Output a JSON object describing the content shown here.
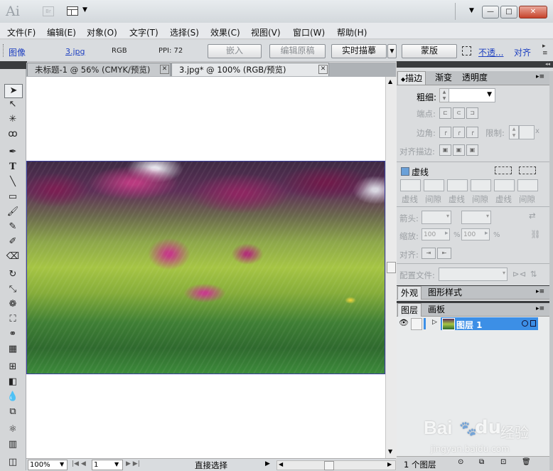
{
  "app": {
    "logo": "Ai",
    "bridge_badge": "Br"
  },
  "window_controls": {
    "minimize": "—",
    "maximize": "□",
    "close": "✕"
  },
  "menu": [
    "文件(F)",
    "编辑(E)",
    "对象(O)",
    "文字(T)",
    "选择(S)",
    "效果(C)",
    "视图(V)",
    "窗口(W)",
    "帮助(H)"
  ],
  "control_bar": {
    "object_type": "图像",
    "filename": "3.jpg",
    "color_mode": "RGB",
    "ppi": "PPI: 72",
    "embed_button": "嵌入",
    "edit_original_button": "编辑原稿",
    "live_trace_button": "实时描摹",
    "mask_button": "蒙版",
    "opacity_link": "不透...",
    "align_link": "对齐"
  },
  "tabs": [
    {
      "label": "未标题-1 @ 56% (CMYK/预览)",
      "active": false
    },
    {
      "label": "3.jpg* @ 100% (RGB/预览)",
      "active": true
    }
  ],
  "status_bar": {
    "zoom": "100%",
    "artboard": "1",
    "tool_status": "直接选择"
  },
  "stroke_panel": {
    "tabs": [
      "描边",
      "渐变",
      "透明度"
    ],
    "weight_label": "粗细:",
    "cap_label": "端点:",
    "corner_label": "边角:",
    "limit_label": "限制:",
    "limit_suffix": "x",
    "align_stroke_label": "对齐描边:",
    "dashed_label": "虚线",
    "dash_labels": [
      "虚线",
      "间隙",
      "虚线",
      "间隙",
      "虚线",
      "间隙"
    ],
    "arrow_label": "箭头:",
    "scale_label": "缩放:",
    "scale_start": "100",
    "scale_end": "100",
    "percent": "%",
    "align_label": "对齐:",
    "profile_label": "配置文件:"
  },
  "appearance_panel": {
    "tabs": [
      "外观",
      "图形样式"
    ]
  },
  "layers_panel": {
    "tabs": [
      "图层",
      "画板"
    ],
    "layers": [
      {
        "name": "图层 1"
      }
    ],
    "footer_count": "1 个图层"
  },
  "watermark": {
    "brand": "Bai",
    "paw": "du",
    "site_cn": "经验",
    "url": "jingyan.baidu.com"
  },
  "colors": {
    "layer_highlight": "#3c8fe6",
    "link_blue": "#1d3fc0",
    "flowers": "#8b1f5a",
    "grass": "#7aa434"
  }
}
